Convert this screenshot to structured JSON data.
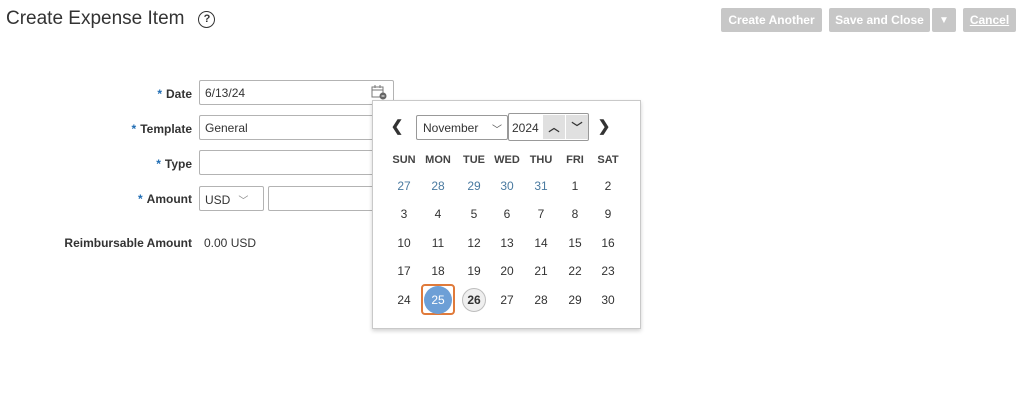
{
  "header": {
    "title": "Create Expense Item",
    "help_icon": "?",
    "buttons": {
      "create_another": "Create Another",
      "save_and_close": "Save and Close",
      "save_menu_caret": "▼",
      "cancel": "Cancel"
    }
  },
  "form": {
    "date": {
      "label": "Date",
      "required": "*",
      "value": "6/13/24"
    },
    "template": {
      "label": "Template",
      "required": "*",
      "value": "General"
    },
    "type": {
      "label": "Type",
      "required": "*",
      "value": ""
    },
    "amount": {
      "label": "Amount",
      "required": "*",
      "currency": "USD",
      "value": ""
    },
    "reimbursable": {
      "label": "Reimbursable Amount",
      "value": "0.00 USD"
    }
  },
  "calendar": {
    "prev": "❮",
    "next": "❯",
    "month": "November",
    "year": "2024",
    "spin_up": "^",
    "spin_down": "v",
    "weekdays": [
      "SUN",
      "MON",
      "TUE",
      "WED",
      "THU",
      "FRI",
      "SAT"
    ],
    "weeks": [
      [
        "27",
        "28",
        "29",
        "30",
        "31",
        "1",
        "2"
      ],
      [
        "3",
        "4",
        "5",
        "6",
        "7",
        "8",
        "9"
      ],
      [
        "10",
        "11",
        "12",
        "13",
        "14",
        "15",
        "16"
      ],
      [
        "17",
        "18",
        "19",
        "20",
        "21",
        "22",
        "23"
      ],
      [
        "24",
        "25",
        "26",
        "27",
        "28",
        "29",
        "30"
      ]
    ],
    "selected_day": "25",
    "today": "26"
  },
  "colors": {
    "button_bg": "#c7c7c7",
    "required_star": "#1f6cb3",
    "selected_day": "#6d9fd6",
    "focus_ring": "#e07a3a"
  }
}
